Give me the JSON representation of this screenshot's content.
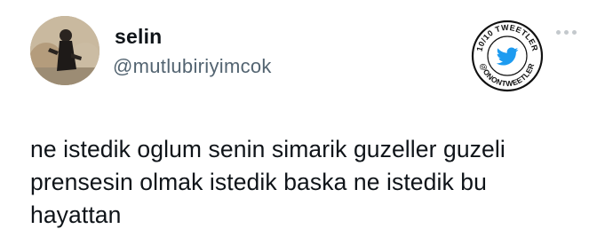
{
  "user": {
    "display_name": "selin",
    "handle": "@mutlubiriyimcok",
    "avatar_icon": "profile-photo"
  },
  "badge": {
    "top_text": "10/10 TWEETLER",
    "bottom_text": "@ONONTWEETLER",
    "icon": "twitter-bird-icon",
    "bird_color": "#1d9bf0"
  },
  "menu": {
    "icon": "more-options-icon"
  },
  "tweet": {
    "lines": [
      "ne istedik oglum senin simarik guzeller guzeli",
      "prensesin olmak istedik baska ne istedik bu",
      "hayattan"
    ]
  },
  "colors": {
    "text": "#0f1419",
    "secondary": "#536471"
  }
}
